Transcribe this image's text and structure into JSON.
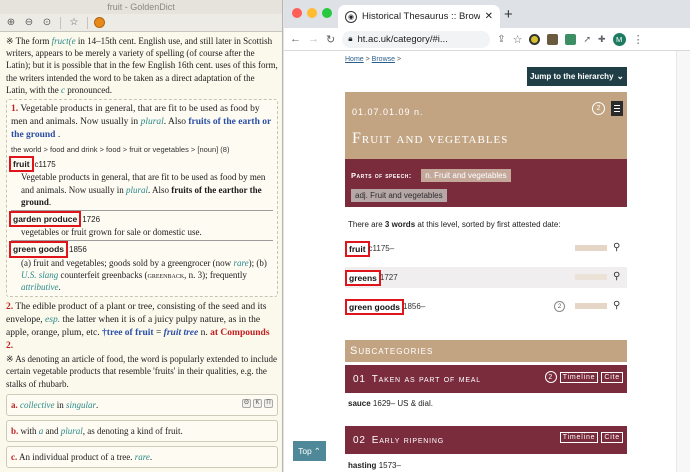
{
  "left_app": {
    "title": "fruit - GoldenDict",
    "intro": {
      "text_1": "※ The form ",
      "italic_1": "fruct(e",
      "text_2": " in 14–15th cent. English use, and still later in Scottish writers, appears to be merely a variety of spelling (of course after the Latin); but it is possible that in the few English 16th cent. uses of this form, the writers intended the word to be taken as a direct adaptation of the Latin, with the ",
      "italic_2": "c",
      "text_3": " pronounced."
    },
    "sense1": {
      "num": "1.",
      "text_1": " Vegetable products in general, that are fit to be used as food by men and animals. Now usually in ",
      "italic": "plural",
      "text_2": ". Also ",
      "link": "fruits of the earth or the ground",
      "text_3": " .",
      "path": "the world > food and drink > food > fruit or vegetables > [noun] (8)",
      "entries": [
        {
          "word": "fruit",
          "date": "c1175",
          "def_1": "Vegetable products in general, that are fit to be used as food by men and animals. Now usually in ",
          "def_italic": "plural",
          "def_2": ". Also ",
          "def_bold": "fruits of the earthor the ground",
          "def_3": "."
        },
        {
          "word": "garden produce",
          "date": "1726",
          "def_1": "vegetables or fruit grown for sale or domestic use."
        },
        {
          "word": "green goods",
          "date": "1856",
          "def_1": "(a) fruit and vegetables; goods sold by a greengrocer (now ",
          "def_italic": "rare",
          "def_2": "); (b) ",
          "def_italic2": "U.S. slang",
          "def_3": " counterfeit greenbacks (",
          "def_sc": "greenback",
          "def_4": ", n. 3); frequently ",
          "def_italic3": "attributive",
          "def_5": "."
        }
      ]
    },
    "sense2": {
      "num": "2.",
      "text_1": " The edible product of a plant or tree, consisting of the seed and its envelope, ",
      "italic_1": "esp.",
      "text_2": " the latter when it is of a juicy pulpy nature, as in the apple, orange, plum, etc. ",
      "link_1": "†tree of fruit",
      "text_3": " = ",
      "italic_link": "fruit tree",
      "text_4": " n. ",
      "red": "at Compounds 2.",
      "note": "※ As denoting an article of food, the word is popularly extended to include certain vegetable products that resemble 'fruits' in their qualities, e.g. the stalks of rhubarb."
    },
    "sense_a": {
      "label": "a.",
      "italic_1": "collective",
      "text_1": " in ",
      "italic_2": "singular",
      "text_2": "."
    },
    "sense_b": {
      "label": "b.",
      "text_1": " with ",
      "italic_1": "a",
      "text_2": " and ",
      "italic_2": "plural",
      "text_3": ", as denoting a kind of fruit."
    },
    "sense_c": {
      "label": "c.",
      "text_1": " An individual product of a tree. ",
      "italic_1": "rare",
      "text_2": "."
    },
    "box_buttons": [
      "Θ",
      "K",
      "П"
    ]
  },
  "browser": {
    "tab_title": "Historical Thesaurus :: Browse",
    "url": "ht.ac.uk/category/#i...",
    "avatar": "M",
    "breadcrumb": {
      "home": "Home",
      "browse": "Browse",
      "sep": " > "
    },
    "jump_label": "Jump to the hierarchy",
    "category": {
      "code": "01.07.01.09 n.",
      "title": "Fruit and vegetables",
      "circle": "2",
      "pos_label": "Parts of speech:",
      "pos_active": "n. Fruit and vegetables",
      "pos_other": "adj. Fruit and vegetables"
    },
    "count_text_1": "There are ",
    "count_bold": "3 words",
    "count_text_2": " at this level, sorted by first attested date:",
    "words": [
      {
        "word": "fruit",
        "date": "c1175–"
      },
      {
        "word": "greens",
        "date": "1727"
      },
      {
        "word": "green goods",
        "date": "1856–",
        "badge": "2"
      }
    ],
    "subcategories_label": "Subcategories",
    "subcategories": [
      {
        "num": "01",
        "title": "Taken as part of meal",
        "badge": "2",
        "timeline": "Timeline",
        "cite": "Cite",
        "first_word": "sauce",
        "first_date": "1629– US & dial."
      },
      {
        "num": "02",
        "title": "Early ripening",
        "timeline": "Timeline",
        "cite": "Cite",
        "first_word": "hasting",
        "first_date": "1573–"
      }
    ],
    "top_label": "Top"
  },
  "colors": {
    "hero": "#c2a483",
    "maroon": "#7a2c3d",
    "highlight_box": "#e0151c",
    "jump": "#1f3e46"
  }
}
